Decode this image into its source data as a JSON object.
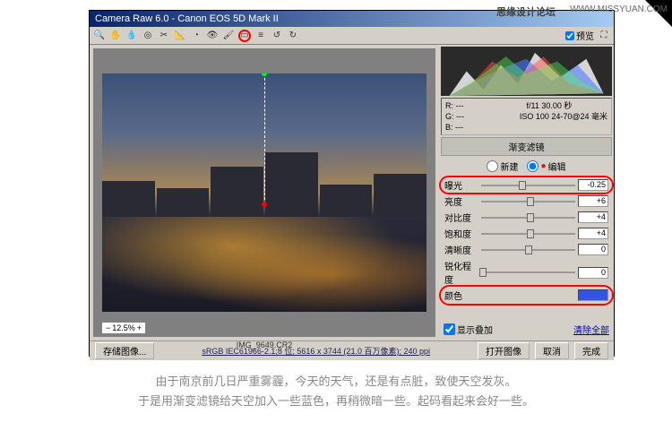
{
  "watermark": {
    "cn": "思缘设计论坛",
    "url": "WWW.MISSYUAN.COM"
  },
  "title": "Camera Raw 6.0 - Canon EOS 5D Mark II",
  "preview_label": "预览",
  "info": {
    "r": "R: ---",
    "g": "G: ---",
    "b": "B: ---",
    "aperture": "f/11  30.00 秒",
    "iso": "ISO 100  24-70@24 毫米"
  },
  "panel_title": "渐变滤镜",
  "radio": {
    "new": "新建",
    "edit": "编辑"
  },
  "sliders": {
    "exposure": {
      "label": "曝光",
      "value": "-0.25",
      "pos": 44
    },
    "brightness": {
      "label": "亮度",
      "value": "+6",
      "pos": 52
    },
    "contrast": {
      "label": "对比度",
      "value": "+4",
      "pos": 52
    },
    "saturation": {
      "label": "饱和度",
      "value": "+4",
      "pos": 52
    },
    "clarity": {
      "label": "清晰度",
      "value": "0",
      "pos": 50
    },
    "sharpness": {
      "label": "锐化程度",
      "value": "0",
      "pos": 2
    },
    "color": {
      "label": "颜色"
    }
  },
  "show_overlay": "显示叠加",
  "clear_all": "清除全部",
  "zoom": "12.5%",
  "filename": "IMG_9649.CR2",
  "footer": {
    "save": "存储图像...",
    "info": "sRGB IEC61966-2.1;8 位; 5616 x 3744 (21.0 百万像素); 240 ppi",
    "open": "打开图像",
    "cancel": "取消",
    "done": "完成"
  },
  "caption": {
    "line1": "由于南京前几日严重雾霾，今天的天气，还是有点脏，致使天空发灰。",
    "line2": "于是用渐变滤镜给天空加入一些蓝色，再稍微暗一些。起码看起来会好一些。"
  }
}
